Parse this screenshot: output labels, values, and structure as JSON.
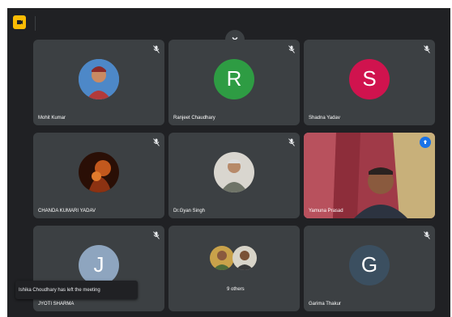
{
  "close_label": "×",
  "participants": [
    {
      "name": "Mohit Kumar",
      "initial": ""
    },
    {
      "name": "Ranjeet Chaudhary",
      "initial": "R",
      "color": "#2e9c43"
    },
    {
      "name": "Shadna Yadav",
      "initial": "S",
      "color": "#d0134e"
    },
    {
      "name": "CHANDA KUMARI YADAV",
      "initial": ""
    },
    {
      "name": "Dr.Gyan Singh",
      "initial": ""
    },
    {
      "name": "Yamuna Prasad",
      "initial": ""
    },
    {
      "name": "JYOTI SHARMA",
      "initial": "J",
      "color": "#8ea5bf"
    },
    {
      "name": "9 others",
      "initial": ""
    },
    {
      "name": "Garima Thakur",
      "initial": "G",
      "color": "#3b4f60"
    }
  ],
  "notification": {
    "text": "Ishika Choudhary has left the meeting"
  },
  "icons": {
    "app": "meet-logo-icon",
    "mic": "mic-off-icon",
    "pin": "pin-icon"
  }
}
